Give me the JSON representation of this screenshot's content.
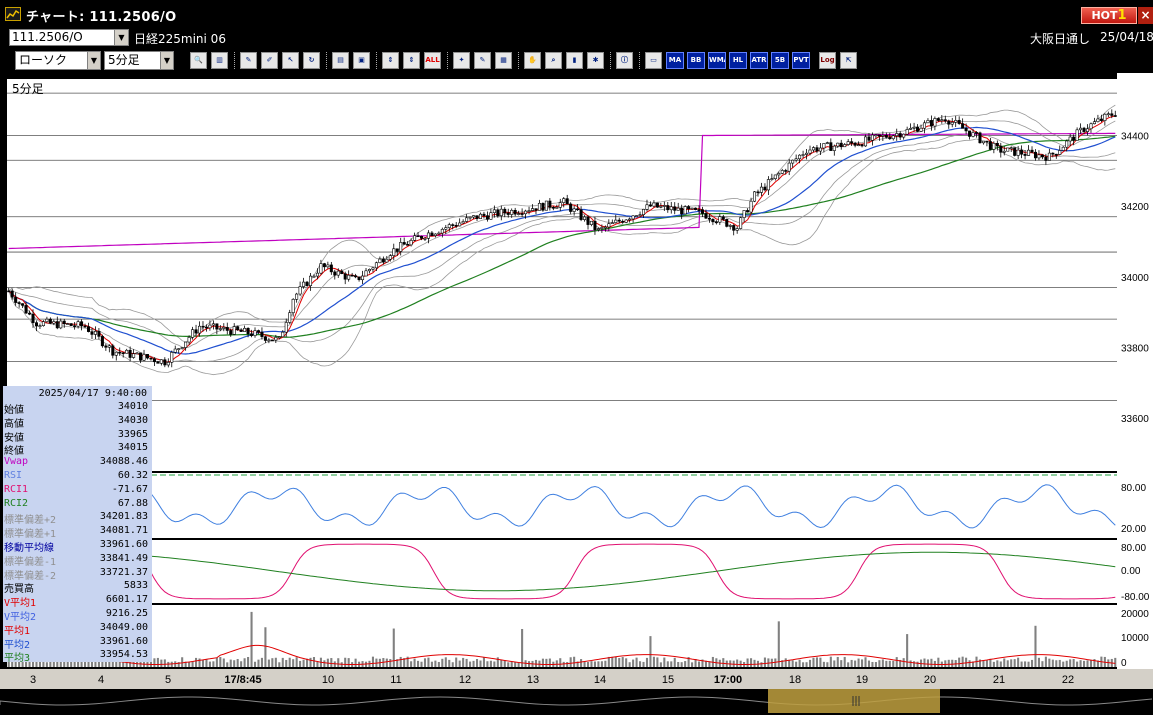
{
  "window": {
    "title": "チャート: 111.2506/O",
    "hot_label": "HOT",
    "hot_num": "1",
    "close_label": "×"
  },
  "instrument": {
    "code": "111.2506/O",
    "name": "日経225mini 06",
    "market": "大阪日通し",
    "date": "25/04/18"
  },
  "toolbar": {
    "chart_type": "ローソク",
    "interval": "5分足",
    "label_buttons": [
      "ALL",
      "MA",
      "BB",
      "WMA",
      "HL",
      "ATR",
      "5B",
      "PVT",
      "Log"
    ],
    "icons": [
      "zoom-icon",
      "bars-icon",
      "pen-icon",
      "eraser-icon",
      "cursor-icon",
      "refresh-icon",
      "print-icon",
      "save-icon",
      "candle-move-icon",
      "candle-mark-icon",
      "all-icon",
      "tools-icon",
      "paint-icon",
      "color-icon",
      "hand-icon",
      "search-chart-icon",
      "bar-chart-icon",
      "signal-icon",
      "info-icon",
      "grid-icon",
      "log-icon",
      "export-icon"
    ]
  },
  "chart": {
    "period_label": "5分足",
    "y_labels": [
      "34400",
      "34200",
      "34000",
      "33800",
      "33600"
    ],
    "rsi_labels": [
      "80.00",
      "20.00"
    ],
    "rci_labels": [
      "80.00",
      "0.00",
      "-80.00"
    ],
    "vol_labels": [
      "20000",
      "10000",
      "0"
    ],
    "x_labels": [
      "3",
      "4",
      "5",
      "17/8:45",
      "10",
      "11",
      "12",
      "13",
      "14",
      "15",
      "17:00",
      "18",
      "19",
      "20",
      "21",
      "22"
    ],
    "colors": {
      "up": "#ffffff",
      "down": "#000000",
      "ma_short": "#e00000",
      "ma_mid": "#2050d0",
      "ma_long": "#208020",
      "vwap": "#c000c0",
      "bands": "#9a9a9a",
      "rsi": "#4080e0",
      "rci1": "#e01070",
      "rci2": "#208020",
      "volume": "#808080"
    }
  },
  "datapanel": {
    "time": "2025/04/17 9:40:00",
    "rows": [
      {
        "k": "始値",
        "v": "34010",
        "c": "#000"
      },
      {
        "k": "高値",
        "v": "34030",
        "c": "#000"
      },
      {
        "k": "安値",
        "v": "33965",
        "c": "#000"
      },
      {
        "k": "終値",
        "v": "34015",
        "c": "#000"
      },
      {
        "k": "Vwap",
        "v": "34088.46",
        "c": "#c000c0"
      },
      {
        "k": "RSI",
        "v": "60.32",
        "c": "#6080e0"
      },
      {
        "k": "RCI1",
        "v": "-71.67",
        "c": "#e01070"
      },
      {
        "k": "RCI2",
        "v": "67.88",
        "c": "#208020"
      },
      {
        "k": "標準偏差+2",
        "v": "34201.83",
        "c": "#909090"
      },
      {
        "k": "標準偏差+1",
        "v": "34081.71",
        "c": "#909090"
      },
      {
        "k": "移動平均線",
        "v": "33961.60",
        "c": "#0000a0"
      },
      {
        "k": "標準偏差-1",
        "v": "33841.49",
        "c": "#909090"
      },
      {
        "k": "標準偏差-2",
        "v": "33721.37",
        "c": "#909090"
      },
      {
        "k": "売買高",
        "v": "5833",
        "c": "#000"
      },
      {
        "k": "V平均1",
        "v": "6601.17",
        "c": "#e00000"
      },
      {
        "k": "V平均2",
        "v": "9216.25",
        "c": "#4060e0"
      },
      {
        "k": "平均1",
        "v": "34049.00",
        "c": "#e00000"
      },
      {
        "k": "平均2",
        "v": "33961.60",
        "c": "#2050d0"
      },
      {
        "k": "平均3",
        "v": "33954.53",
        "c": "#208020"
      }
    ]
  }
}
